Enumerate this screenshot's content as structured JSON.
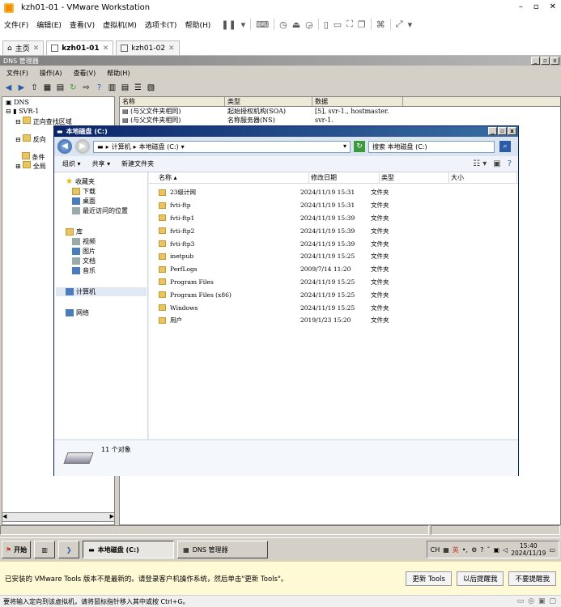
{
  "vmware": {
    "title": "kzh01-01 - VMware Workstation",
    "menu": [
      "文件(F)",
      "编辑(E)",
      "查看(V)",
      "虚拟机(M)",
      "选项卡(T)",
      "帮助(H)"
    ],
    "tabs": [
      {
        "label": "主页"
      },
      {
        "label": "kzh01-01"
      },
      {
        "label": "kzh01-02"
      }
    ],
    "notify_text": "已安装的 VMware Tools 版本不是最新的。请登录客户机操作系统，然后单击\"更新 Tools\"。",
    "notify_buttons": {
      "update": "更新 Tools",
      "later": "以后提醒我",
      "never": "不要提醒我"
    },
    "status_text": "要将输入定向到该虚拟机，请将鼠标指针移入其中或按 Ctrl+G。"
  },
  "dns": {
    "title": "DNS 管理器",
    "menu": [
      "文件(F)",
      "操作(A)",
      "查看(V)",
      "帮助(H)"
    ],
    "tree": [
      {
        "label": "DNS"
      },
      {
        "label": "SVR-1"
      },
      {
        "label": "正向查找区域"
      },
      {
        "label": "反向"
      },
      {
        "label": "条件"
      },
      {
        "label": "全局"
      }
    ],
    "columns": [
      "名称",
      "类型",
      "数据"
    ],
    "rows": [
      {
        "name": "(与父文件夹相同)",
        "type": "起始授权机构(SOA)",
        "data": "[5], svr-1., hostmaster."
      },
      {
        "name": "(与父文件夹相同)",
        "type": "名称服务器(NS)",
        "data": "svr-1."
      }
    ]
  },
  "explorer": {
    "title": "本地磁盘 (C:)",
    "breadcrumb": [
      "计算机",
      "本地磁盘 (C:)"
    ],
    "search_placeholder": "搜索 本地磁盘 (C:)",
    "commands": {
      "organize": "组织",
      "share": "共享",
      "new_folder": "新建文件夹"
    },
    "nav": {
      "favorites": "收藏夹",
      "downloads": "下载",
      "desktop": "桌面",
      "recent": "最近访问的位置",
      "libraries": "库",
      "videos": "视频",
      "pictures": "图片",
      "documents": "文档",
      "music": "音乐",
      "computer": "计算机",
      "network": "网络"
    },
    "columns": {
      "name": "名称",
      "date": "修改日期",
      "type": "类型",
      "size": "大小"
    },
    "files": [
      {
        "name": "23级计网",
        "date": "2024/11/19 15:31",
        "type": "文件夹"
      },
      {
        "name": "fvti-ftp",
        "date": "2024/11/19 15:31",
        "type": "文件夹"
      },
      {
        "name": "fvti-ftp1",
        "date": "2024/11/19 15:39",
        "type": "文件夹"
      },
      {
        "name": "fvti-ftp2",
        "date": "2024/11/19 15:39",
        "type": "文件夹"
      },
      {
        "name": "fvti-ftp3",
        "date": "2024/11/19 15:39",
        "type": "文件夹"
      },
      {
        "name": "inetpub",
        "date": "2024/11/19 15:25",
        "type": "文件夹"
      },
      {
        "name": "PerfLogs",
        "date": "2009/7/14 11:20",
        "type": "文件夹"
      },
      {
        "name": "Program Files",
        "date": "2024/11/19 15:25",
        "type": "文件夹"
      },
      {
        "name": "Program Files (x86)",
        "date": "2024/11/19 15:25",
        "type": "文件夹"
      },
      {
        "name": "Windows",
        "date": "2024/11/19 15:25",
        "type": "文件夹"
      },
      {
        "name": "用户",
        "date": "2019/1/23 15:20",
        "type": "文件夹"
      }
    ],
    "item_count": "11 个对象"
  },
  "taskbar": {
    "start": "开始",
    "tasks": [
      {
        "label": "本地磁盘 (C:)"
      },
      {
        "label": "DNS 管理器"
      }
    ],
    "lang": "CH",
    "ime": "英",
    "time": "15:40",
    "date": "2024/11/19"
  }
}
